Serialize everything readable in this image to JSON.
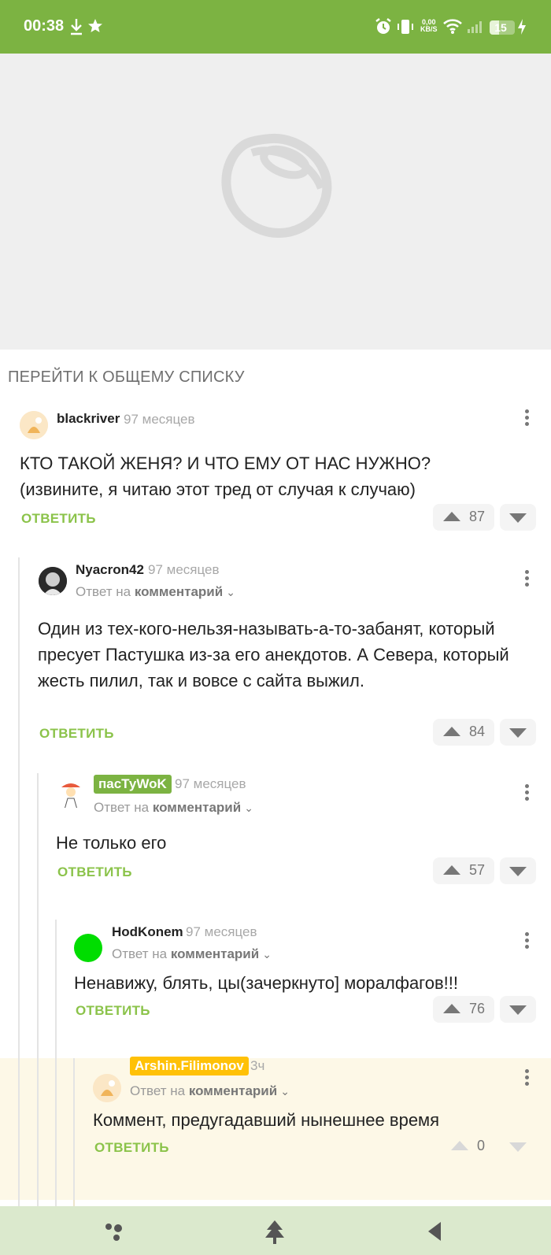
{
  "status_bar": {
    "time": "00:38",
    "net_speed_value": "0,00",
    "net_speed_unit": "KB/S",
    "battery": "15"
  },
  "navigation": {
    "goto_list_label": "ПЕРЕЙТИ К ОБЩЕМУ СПИСКУ"
  },
  "comments": [
    {
      "author": "blackriver",
      "time": "97 месяцев",
      "text": "КТО ТАКОЙ ЖЕНЯ? И ЧТО ЕМУ ОТ НАС НУЖНО?\n(извините, я читаю этот тред от случая к случаю)",
      "reply_label": "ОТВЕТИТЬ",
      "score": "87"
    },
    {
      "author": "Nyacron42",
      "time": "97 месяцев",
      "reply_to_prefix": "Ответ на",
      "reply_to_target": "комментарий",
      "text": "Один из тех-кого-нельзя-называть-а-то-забанят, который пресует Пастушка из-за его анекдотов. А Севера, который жесть пилил, так и вовсе с сайта выжил.",
      "reply_label": "ОТВЕТИТЬ",
      "score": "84"
    },
    {
      "author": "пасТуWoK",
      "time": "97 месяцев",
      "reply_to_prefix": "Ответ на",
      "reply_to_target": "комментарий",
      "text": "Не только его",
      "reply_label": "ОТВЕТИТЬ",
      "score": "57"
    },
    {
      "author": "HodKonem",
      "time": "97 месяцев",
      "reply_to_prefix": "Ответ на",
      "reply_to_target": "комментарий",
      "text": "Ненавижу, блять, цы(зачеркнуто] моралфагов!!!",
      "reply_label": "ОТВЕТИТЬ",
      "score": "76"
    },
    {
      "author": "Arshin.Filimonov",
      "time": "3ч",
      "reply_to_prefix": "Ответ на",
      "reply_to_target": "комментарий",
      "text": "Коммент, предугадавший нынешнее время",
      "reply_label": "ОТВЕТИТЬ",
      "score": "0"
    }
  ],
  "colors": {
    "brand_green": "#7cb342",
    "reply_green": "#8bc34a",
    "badge_yellow": "#ffc107",
    "highlight_bg": "#fdf8e7"
  }
}
